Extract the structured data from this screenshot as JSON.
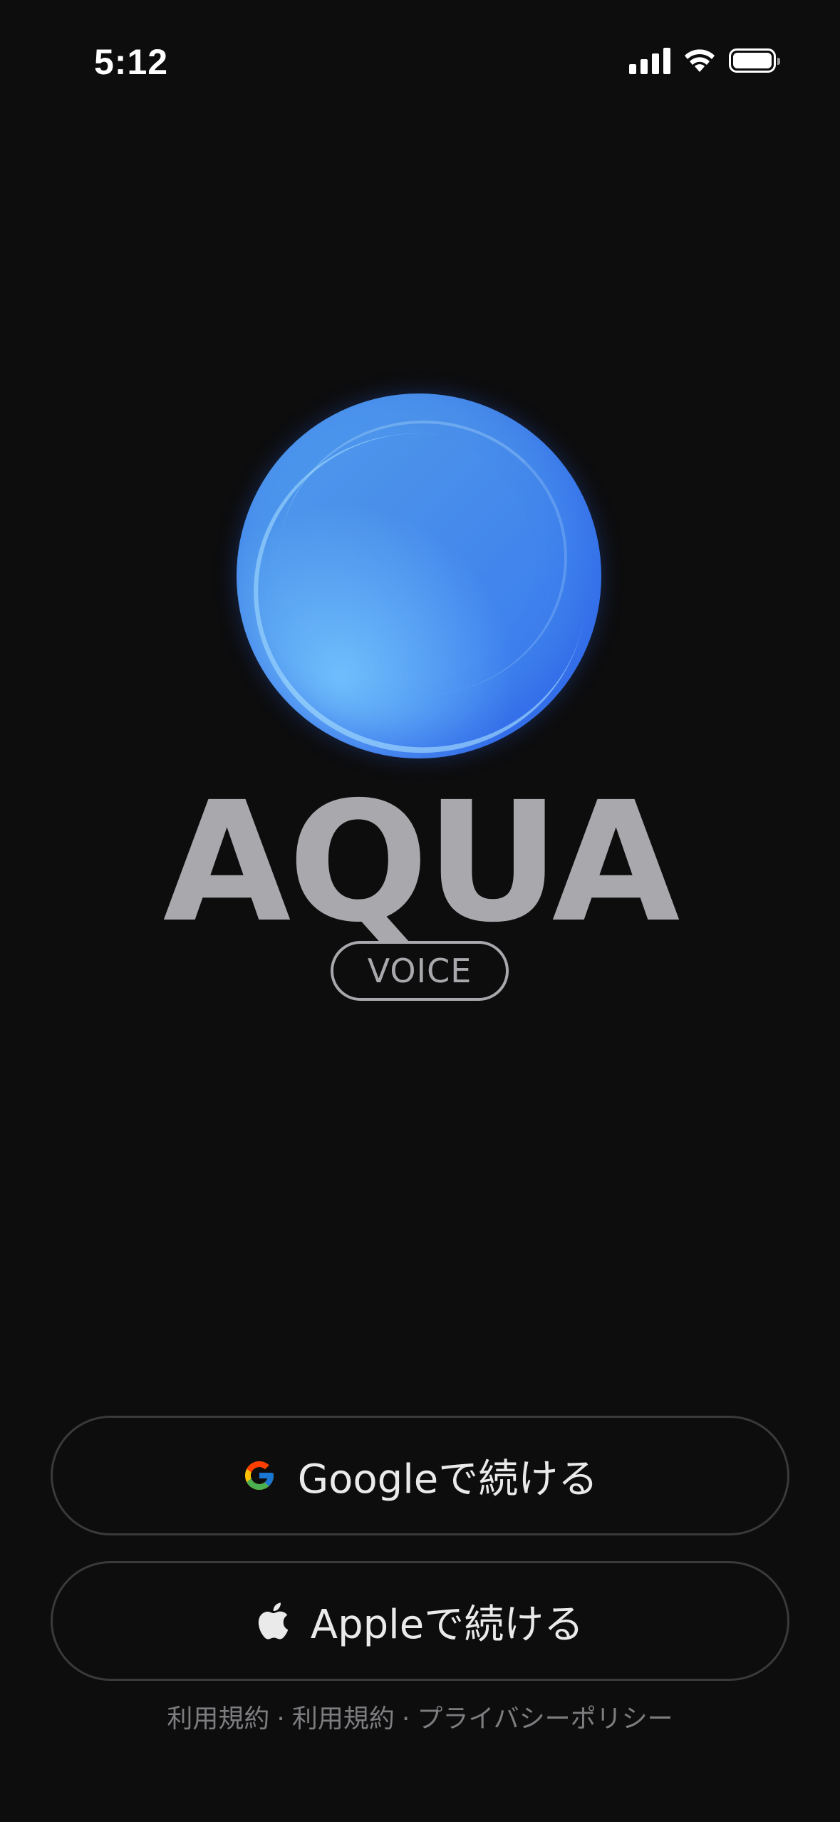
{
  "status_bar": {
    "time": "5:12",
    "icons": [
      "cellular-signal-icon",
      "wifi-icon",
      "battery-icon"
    ]
  },
  "logo": {
    "title": "AQUA",
    "badge": "VOICE",
    "orb_colors": [
      "#4f9cf0",
      "#3a78ea",
      "#78c8ff"
    ]
  },
  "buttons": {
    "google_label": "Googleで続ける",
    "google_icon": "google-g-icon",
    "apple_label": "Appleで続ける",
    "apple_icon": "apple-logo-icon"
  },
  "footer": {
    "link1": "利用規約",
    "link2": "利用規約",
    "link3": "プライバシーポリシー",
    "separator": "·"
  }
}
